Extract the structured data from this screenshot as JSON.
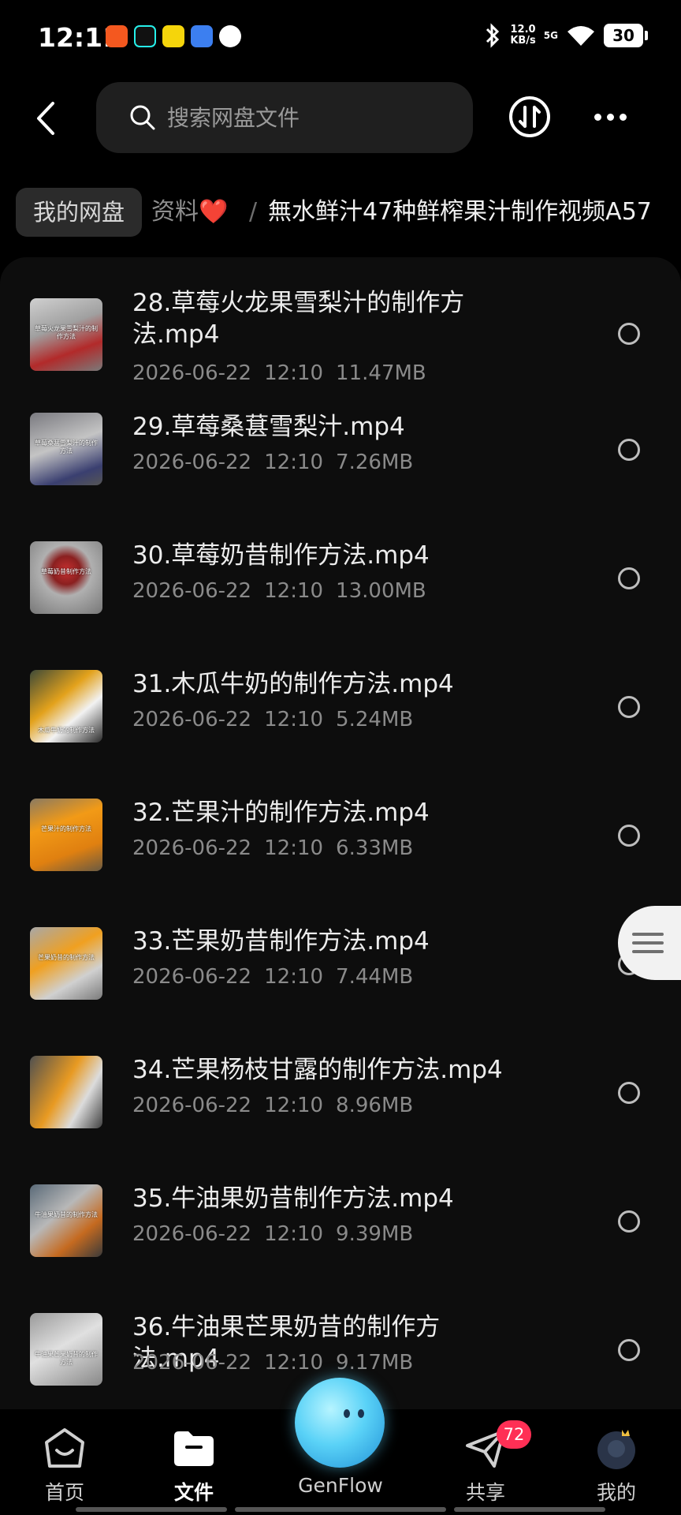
{
  "status_bar": {
    "time": "12:11",
    "speed_value": "12.0",
    "speed_unit": "KB/s",
    "network": "5G",
    "battery": "30",
    "app_icon_colors": [
      "#f4581f",
      "#111111",
      "#f5d50b",
      "#3c7ff0",
      "#ffffff"
    ]
  },
  "top_bar": {
    "search_placeholder": "搜索网盘文件",
    "icons": [
      "back-arrow",
      "search",
      "sort",
      "more"
    ]
  },
  "breadcrumb": {
    "root": "我的网盘",
    "middle": "资料",
    "middle_emoji": "❤️",
    "separator": "/",
    "current": "無水鲜汁47种鲜榨果汁制作视频A57"
  },
  "files": [
    {
      "name": "28.草莓火龙果雪梨汁的制作方法.mp4",
      "date": "2026-06-22",
      "time": "12:10",
      "size": "11.47MB",
      "thumb_label": "草莓火龙果雪梨汁的制作方法",
      "thumb_colors": [
        "#c9c9c9",
        "#b22a2a"
      ]
    },
    {
      "name": "29.草莓桑葚雪梨汁.mp4",
      "date": "2026-06-22",
      "time": "12:10",
      "size": "7.26MB",
      "thumb_label": "草莓桑葚雪梨汁的制作方法",
      "thumb_colors": [
        "#6f6f78",
        "#3a3f70"
      ]
    },
    {
      "name": "30.草莓奶昔制作方法.mp4",
      "date": "2026-06-22",
      "time": "12:10",
      "size": "13.00MB",
      "thumb_label": "草莓奶昔制作方法",
      "thumb_colors": [
        "#a8a8a8",
        "#c73030"
      ]
    },
    {
      "name": "31.木瓜牛奶的制作方法.mp4",
      "date": "2026-06-22",
      "time": "12:10",
      "size": "5.24MB",
      "thumb_label": "木瓜牛奶的制作方法",
      "thumb_colors": [
        "#4e5a48",
        "#e3a21c"
      ]
    },
    {
      "name": "32.芒果汁的制作方法.mp4",
      "date": "2026-06-22",
      "time": "12:10",
      "size": "6.33MB",
      "thumb_label": "芒果汁的制作方法",
      "thumb_colors": [
        "#7a6a52",
        "#f29a16"
      ]
    },
    {
      "name": "33.芒果奶昔制作方法.mp4",
      "date": "2026-06-22",
      "time": "12:10",
      "size": "7.44MB",
      "thumb_label": "芒果奶昔的制作方法",
      "thumb_colors": [
        "#9a9a9a",
        "#f0a020"
      ]
    },
    {
      "name": "34.芒果杨枝甘露的制作方法.mp4",
      "date": "2026-06-22",
      "time": "12:10",
      "size": "8.96MB",
      "thumb_label": "",
      "thumb_colors": [
        "#606060",
        "#e89a22"
      ]
    },
    {
      "name": "35.牛油果奶昔制作方法.mp4",
      "date": "2026-06-22",
      "time": "12:10",
      "size": "9.39MB",
      "thumb_label": "牛油果奶昔的制作方法",
      "thumb_colors": [
        "#5a6a78",
        "#c56a20"
      ]
    },
    {
      "name": "36.牛油果芒果奶昔的制作方法.mp4",
      "date": "2026-06-22",
      "time": "12:10",
      "size": "9.17MB",
      "thumb_label": "牛油果芒果奶昔的制作方法",
      "thumb_colors": [
        "#b0b0b0",
        "#d8d8d8"
      ]
    }
  ],
  "bottom_nav": {
    "home": "首页",
    "files": "文件",
    "genflow": "GenFlow",
    "share": "共享",
    "share_badge": "72",
    "mine": "我的",
    "active": "files"
  },
  "colors": {
    "background": "#000000",
    "panel": "#0d0d0d",
    "badge": "#ff2f55",
    "heart": "#d9252b"
  }
}
